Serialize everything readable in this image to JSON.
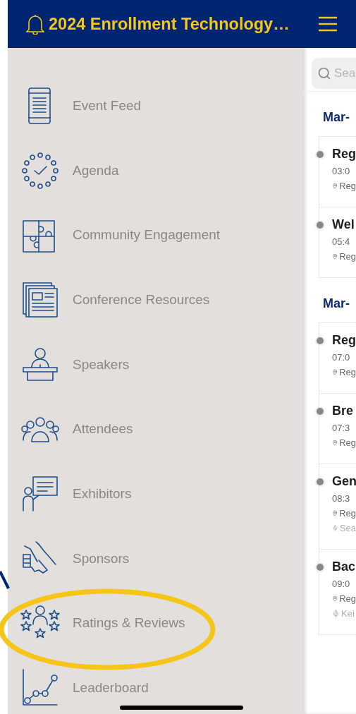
{
  "header": {
    "title": "2024 Enrollment Technology…"
  },
  "menu": [
    {
      "label": "Event Feed",
      "kind": "feed",
      "highlighted": false
    },
    {
      "label": "Agenda",
      "kind": "agenda",
      "highlighted": false
    },
    {
      "label": "Community Engagement",
      "kind": "puzzle",
      "highlighted": false
    },
    {
      "label": "Conference Resources",
      "kind": "news",
      "highlighted": false
    },
    {
      "label": "Speakers",
      "kind": "speaker",
      "highlighted": false
    },
    {
      "label": "Attendees",
      "kind": "people",
      "highlighted": false
    },
    {
      "label": "Exhibitors",
      "kind": "exhibit",
      "highlighted": false
    },
    {
      "label": "Sponsors",
      "kind": "hands",
      "highlighted": false
    },
    {
      "label": "Ratings & Reviews",
      "kind": "ratings",
      "highlighted": true
    },
    {
      "label": "Leaderboard",
      "kind": "chart",
      "highlighted": false
    }
  ],
  "search": {
    "placeholder": "Sea"
  },
  "days": [
    {
      "date": "Mar-",
      "events": [
        {
          "title": "Reg",
          "time": "03:0",
          "location": "Reg"
        },
        {
          "title": "Wel",
          "time": "05:4",
          "location": "Reg"
        }
      ]
    },
    {
      "date": "Mar-",
      "events": [
        {
          "title": "Reg",
          "time": "07:0",
          "location": "Reg"
        },
        {
          "title": "Bre",
          "time": "07:3",
          "location": "Reg"
        },
        {
          "title": "Gen",
          "time": "08:3",
          "location": "Reg",
          "speaker": "Sea"
        },
        {
          "title": "Bac",
          "time": "09:0",
          "location": "Reg",
          "speaker": "Kei"
        }
      ]
    }
  ]
}
